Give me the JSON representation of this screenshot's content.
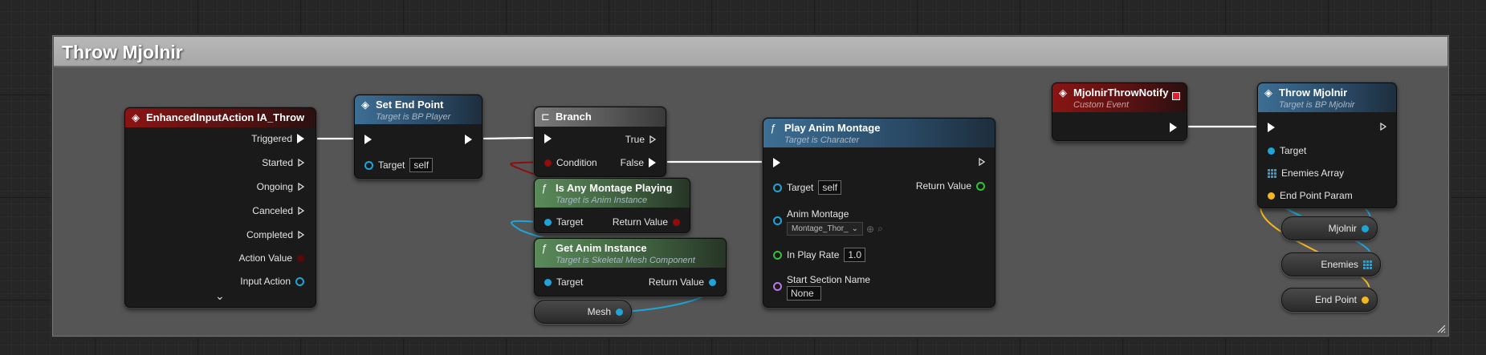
{
  "comment": {
    "title": "Throw Mjolnir"
  },
  "colors": {
    "exec": "#ffffff",
    "object": "#1fa4d8",
    "struct": "#f3b81d",
    "float": "#34c13a",
    "name": "#b878e0",
    "bool": "#8f0d0d",
    "event_header": "#8a1414",
    "function_header": "#3d6e94",
    "pure_header": "#5a8a5a"
  },
  "nodes": {
    "enhanced_input": {
      "title": "EnhancedInputAction IA_Throw",
      "icon": "event-icon",
      "pins": [
        "Triggered",
        "Started",
        "Ongoing",
        "Canceled",
        "Completed",
        "Action Value",
        "Input Action"
      ],
      "expand_icon": "⌄"
    },
    "set_end_point": {
      "title": "Set End Point",
      "subtitle": "Target is BP Player",
      "target_label": "Target",
      "target_value": "self"
    },
    "branch": {
      "title": "Branch",
      "true_label": "True",
      "false_label": "False",
      "condition_label": "Condition"
    },
    "is_any_montage": {
      "title": "Is Any Montage Playing",
      "subtitle": "Target is Anim Instance",
      "target_label": "Target",
      "return_label": "Return Value"
    },
    "get_anim_instance": {
      "title": "Get Anim Instance",
      "subtitle": "Target is Skeletal Mesh Component",
      "target_label": "Target",
      "return_label": "Return Value"
    },
    "mesh_var": {
      "label": "Mesh"
    },
    "play_anim_montage": {
      "title": "Play Anim Montage",
      "subtitle": "Target is Character",
      "target_label": "Target",
      "target_value": "self",
      "return_label": "Return Value",
      "anim_montage_label": "Anim Montage",
      "anim_montage_value": "Montage_Thor_",
      "play_rate_label": "In Play Rate",
      "play_rate_value": "1.0",
      "start_section_label": "Start Section Name",
      "start_section_value": "None"
    },
    "notify_event": {
      "title": "MjolnirThrowNotify",
      "subtitle": "Custom Event"
    },
    "throw_mjolnir": {
      "title": "Throw Mjolnir",
      "subtitle": "Target is BP Mjolnir",
      "target_label": "Target",
      "enemies_label": "Enemies Array",
      "endpoint_label": "End Point Param"
    },
    "var_mjolnir": {
      "label": "Mjolnir"
    },
    "var_enemies": {
      "label": "Enemies"
    },
    "var_endpoint": {
      "label": "End Point"
    }
  }
}
